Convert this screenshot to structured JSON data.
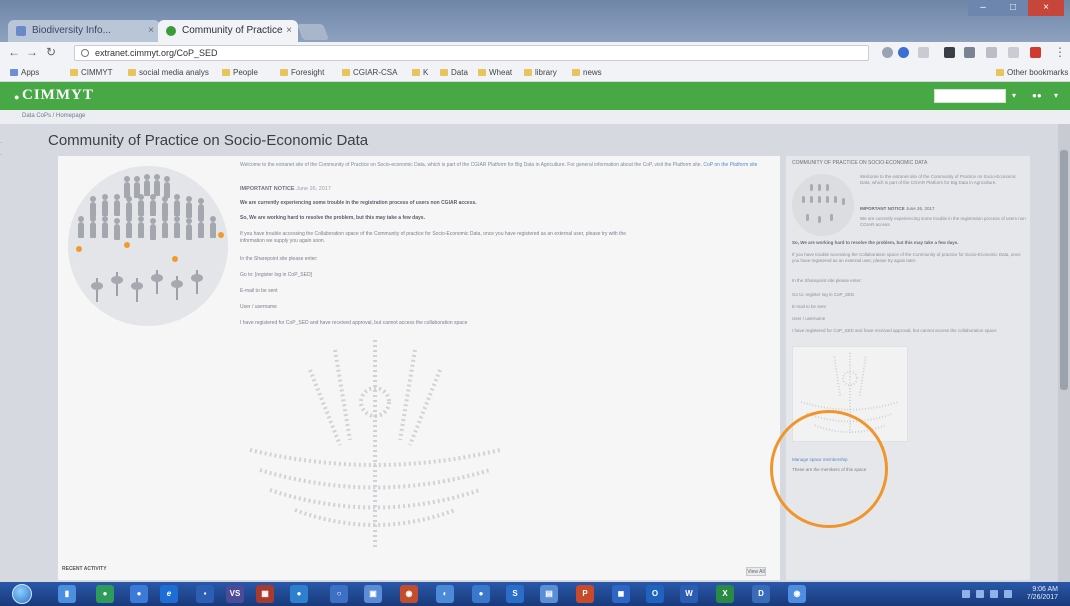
{
  "browser": {
    "tabs": [
      {
        "label": "Biodiversity Info..."
      },
      {
        "label": "Community of Practice"
      }
    ],
    "url": "extranet.cimmyt.org/CoP_SED",
    "bookmarks": [
      "Apps",
      "CIMMYT",
      "social media analys",
      "People",
      "Foresight",
      "CGIAR-CSA",
      "K",
      "Data",
      "Wheat",
      "library",
      "news"
    ],
    "other_bookmarks": "Other bookmarks"
  },
  "site": {
    "logo": "CIMMYT",
    "breadcrumb": "Data CoPs  /  Homepage"
  },
  "page": {
    "title": "Community of Practice on Socio-Economic Data",
    "intro": "Welcome to the extranet site of the Community of Practice on Socio-economic Data, which is part of the CGIAR Platform for Big Data in Agriculture. For general information about the CoP, visit the Platform site.",
    "intro_link": "CoP on the Platform site",
    "update_heading": "IMPORTANT NOTICE",
    "update_date": "June 26, 2017",
    "lines": [
      {
        "text": "We are currently experiencing some trouble in the registration process of users non CGIAR access.",
        "bold": true
      },
      {
        "text": "So, We are working hard to resolve the problem, but this may take a few days.",
        "bold": true
      },
      {
        "text": "If you have trouble accessing the Collaboration space of the Community of practice for Socio-Economic Data, once you have registered as an external user, please try with the",
        "bold": false
      },
      {
        "text": "information we supply you again soon.",
        "bold": false
      },
      {
        "text": "In the Sharepoint site please enter:",
        "bold": false
      },
      {
        "text": "Go to: [register log in CoP_SED]",
        "bold": false
      },
      {
        "text": "E-mail to be sent",
        "bold": false
      },
      {
        "text": "User / username",
        "bold": false
      },
      {
        "text": "I have registered for CoP_SED and have received approval, but cannot access the collaboration space",
        "bold": false
      }
    ],
    "recent_activity": "RECENT ACTIVITY",
    "view_all": "View All"
  },
  "sidebar": {
    "title": "COMMUNITY OF PRACTICE ON SOCIO-ECONOMIC DATA",
    "blurb": "Welcome to the extranet site of the Community of Practice on Socio-Economic Data, which is part of the CGIAR Platform for Big Data in Agriculture.",
    "notice": "IMPORTANT NOTICE",
    "notice_date": "June 26, 2017",
    "notice_body": "We are currently experiencing some trouble in the registration process of users non CGIAR access.",
    "bold_line": "So, We are working hard to resolve the problem, but this may take a few days.",
    "lines": [
      "If you have trouble accessing the Collaboration space of the Community of practice for Socio-Economic Data, once you have registered as an external user, please try again later.",
      "In the Sharepoint site please enter:",
      "Go to: register log in CoP_SED",
      "E-mail to be sent",
      "User / username",
      "I have registered for CoP_SED and have received approval, but cannot access the collaboration space"
    ],
    "link": "Manage space membership",
    "note": "These are the members of this space"
  },
  "taskbar": {
    "time": "9:06 AM",
    "date": "7/26/2017"
  },
  "colors": {
    "brand_green": "#47a845",
    "annotation_orange": "#f0952c",
    "taskbar_blue": "#1f4a94"
  }
}
